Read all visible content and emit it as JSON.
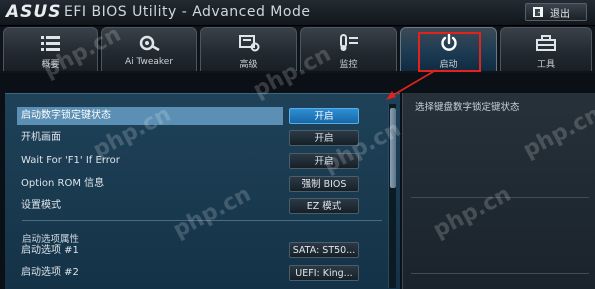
{
  "title_bar": {
    "brand": "ASUS",
    "title": "EFI BIOS Utility - Advanced Mode",
    "exit_label": "退出"
  },
  "tabs": [
    {
      "label": "概要",
      "icon": "list-icon"
    },
    {
      "label": "Ai Tweaker",
      "icon": "tweaker-icon"
    },
    {
      "label": "高级",
      "icon": "advanced-icon"
    },
    {
      "label": "监控",
      "icon": "monitor-icon"
    },
    {
      "label": "启动",
      "icon": "power-icon",
      "active": true
    },
    {
      "label": "工具",
      "icon": "tool-icon"
    }
  ],
  "settings": [
    {
      "label": "启动数字锁定键状态",
      "value": "开启",
      "selected": true
    },
    {
      "label": "开机画面",
      "value": "开启"
    },
    {
      "label": "Wait For 'F1' If Error",
      "value": "开启"
    },
    {
      "label": "Option ROM 信息",
      "value": "强制 BIOS"
    },
    {
      "label": "设置模式",
      "value": "EZ 模式"
    }
  ],
  "boot_section": {
    "title": "启动选项属性",
    "items": [
      {
        "label": "启动选项 #1",
        "value": "SATA: ST50..."
      },
      {
        "label": "启动选项 #2",
        "value": "UEFI: King..."
      }
    ]
  },
  "help": {
    "text": "选择键盘数字锁定键状态"
  },
  "watermark": "php.cn",
  "colors": {
    "highlight": "#e0231d",
    "selected_row": "#5b8fb3",
    "selected_button": "#1867a7"
  }
}
